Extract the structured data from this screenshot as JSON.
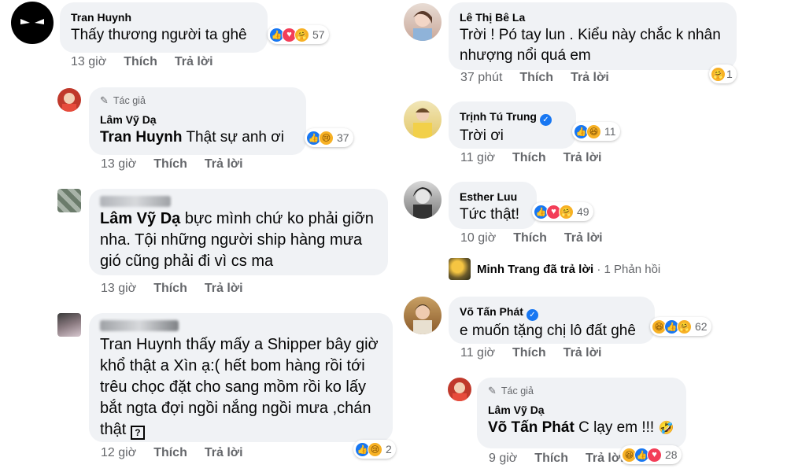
{
  "left": {
    "c1": {
      "name": "Tran Huynh",
      "text": "Thấy thương người ta ghê",
      "time": "13 giờ",
      "like": "Thích",
      "reply": "Trả lời",
      "count": "57"
    },
    "c2": {
      "author_tag": "Tác giả",
      "name": "Lâm Vỹ Dạ",
      "mention": "Tran Huynh",
      "text": "Thật sự anh ơi",
      "time": "13 giờ",
      "like": "Thích",
      "reply": "Trả lời",
      "count": "37"
    },
    "c3": {
      "mention": "Lâm Vỹ Dạ",
      "text1": "bực mình chứ ko phải giỡn",
      "text2": "nha. Tội những người ship hàng mưa",
      "text3": "gió cũng phải đi vì cs ma",
      "time": "13 giờ",
      "like": "Thích",
      "reply": "Trả lời"
    },
    "c4": {
      "mention": "Tran Huynh",
      "text1": "thấy mấy a Shipper bây giờ",
      "text2": "khổ thật a Xìn ạ:( hết bom hàng rồi tới",
      "text3": "trêu chọc đặt cho sang mồm rồi ko lấy",
      "text4": "bắt ngta đợi ngồi nắng ngồi mưa ,chán",
      "text5": "thật",
      "qmark": "?",
      "time": "12 giờ",
      "like": "Thích",
      "reply": "Trả lời",
      "count": "2"
    }
  },
  "right": {
    "c1": {
      "name": "Lê Thị Bê La",
      "text1": "Trời ! Pó tay lun . Kiểu này chắc k nhân",
      "text2": "nhượng nổi quá em",
      "time": "37 phút",
      "like": "Thích",
      "reply": "Trả lời",
      "count": "1"
    },
    "c2": {
      "name": "Trịnh Tú Trung",
      "text": "Trời ơi",
      "time": "11 giờ",
      "like": "Thích",
      "reply": "Trả lời",
      "count": "11"
    },
    "c3": {
      "name": "Esther Luu",
      "text": "Tức thật!",
      "time": "10 giờ",
      "like": "Thích",
      "reply": "Trả lời",
      "count": "49"
    },
    "reply_summary": {
      "name": "Minh Trang",
      "action": "đã trả lời",
      "dot": "·",
      "count": "1 Phản hồi"
    },
    "c4": {
      "name": "Võ Tấn Phát",
      "text": "e muốn tặng chị lô đất ghê",
      "time": "11 giờ",
      "like": "Thích",
      "reply": "Trả lời",
      "count": "62"
    },
    "c5": {
      "author_tag": "Tác giả",
      "name": "Lâm Vỹ Dạ",
      "mention": "Võ Tấn Phát",
      "text": "C lạy em !!!",
      "time": "9 giờ",
      "like": "Thích",
      "reply": "Trả lời",
      "count": "28"
    }
  },
  "icons": {
    "like": "👍",
    "love": "♥",
    "sad": "😢",
    "haha": "😆",
    "care": "🤗",
    "rofl": "🤣",
    "pencil": "✎",
    "check": "✓"
  },
  "colors": {
    "bubble": "#f0f2f5",
    "meta": "#65676b",
    "like_blue": "#1877f2",
    "love_red": "#f33e58"
  }
}
